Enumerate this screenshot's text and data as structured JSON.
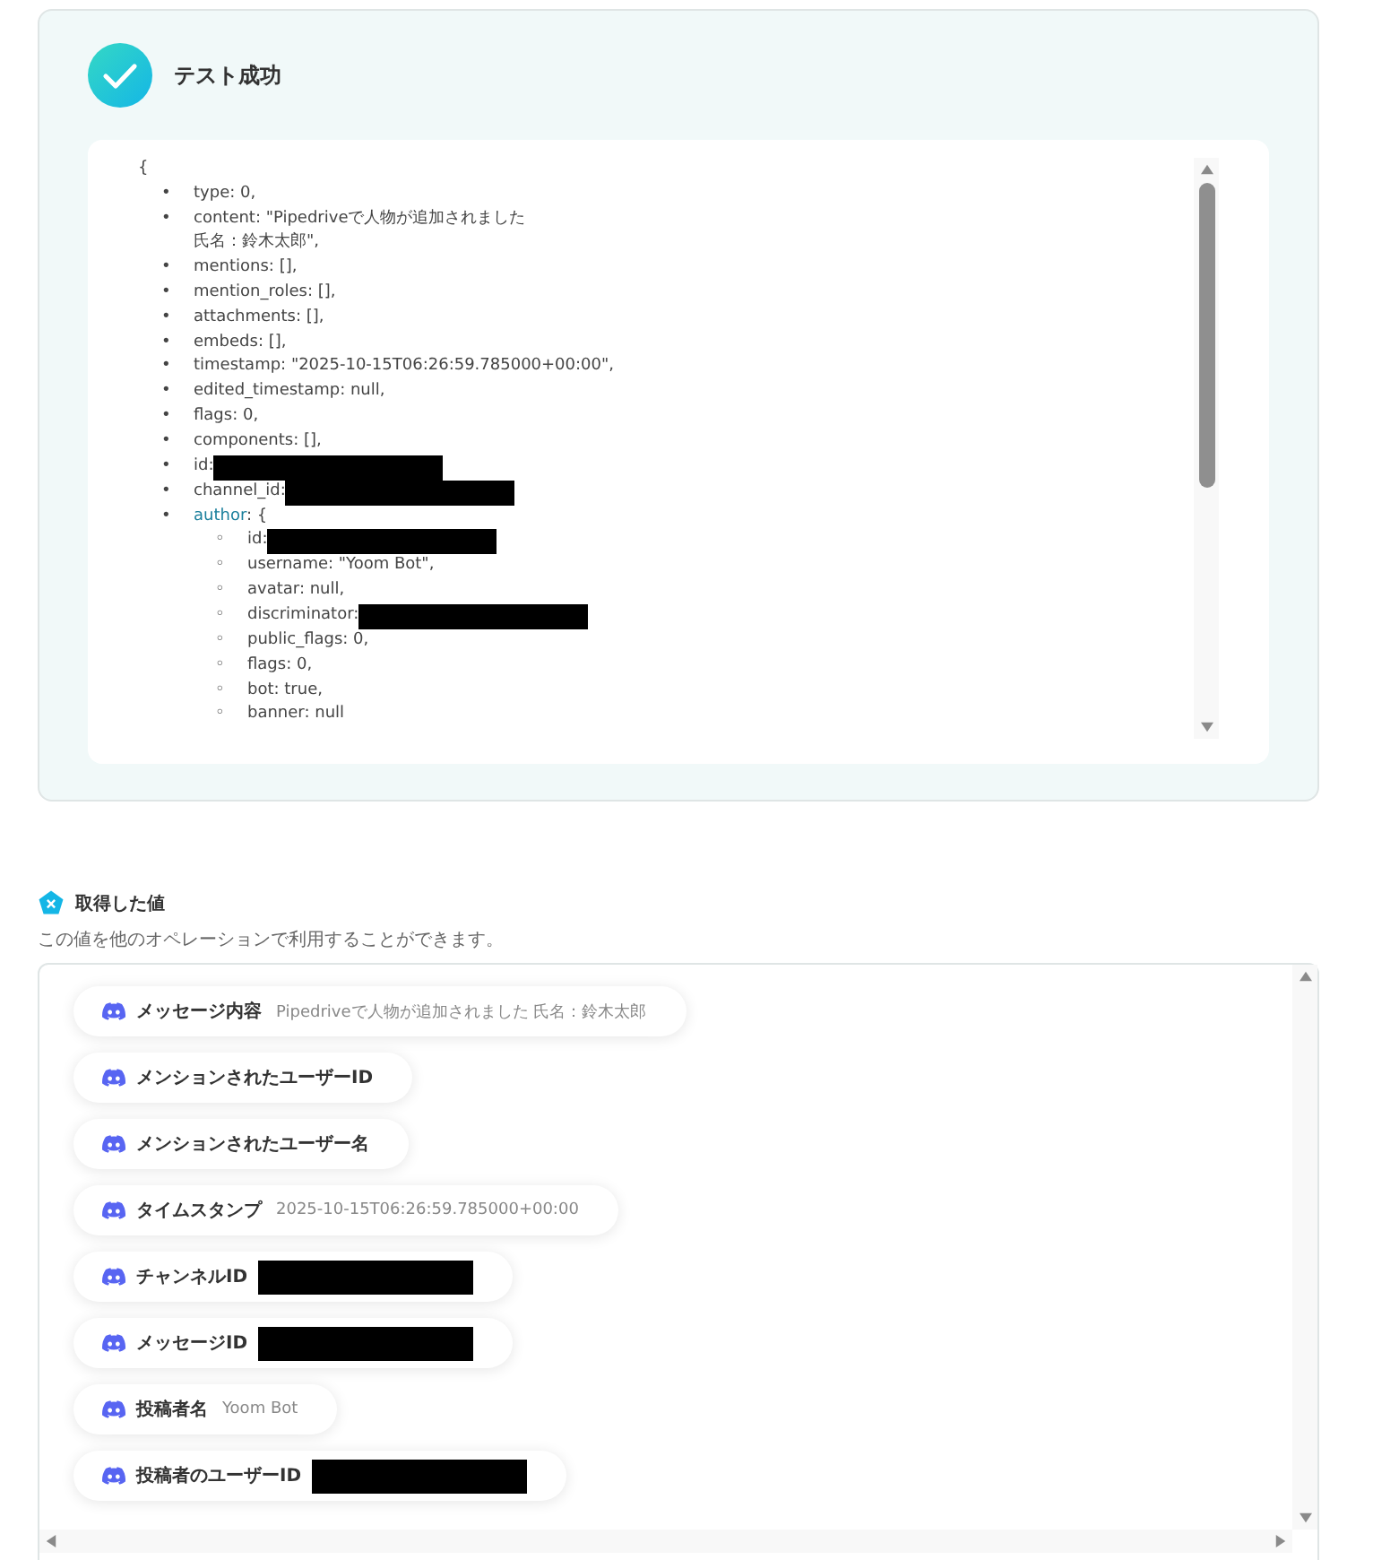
{
  "result": {
    "title": "テスト成功",
    "open_brace": "{",
    "lines": [
      {
        "bullet": "•",
        "text": "type: 0,"
      },
      {
        "bullet": "•",
        "text": "content: \"Pipedriveで人物が追加されました",
        "continuation": "氏名：鈴木太郎\","
      },
      {
        "bullet": "•",
        "text": "mentions: [],"
      },
      {
        "bullet": "•",
        "text": "mention_roles: [],"
      },
      {
        "bullet": "•",
        "text": "attachments: [],"
      },
      {
        "bullet": "•",
        "text": "embeds: [],"
      },
      {
        "bullet": "•",
        "text": "timestamp: \"2025-10-15T06:26:59.785000+00:00\","
      },
      {
        "bullet": "•",
        "text": "edited_timestamp: null,"
      },
      {
        "bullet": "•",
        "text": "flags: 0,"
      },
      {
        "bullet": "•",
        "text": "components: [],"
      },
      {
        "bullet": "•",
        "text": "id:",
        "redacted": true
      },
      {
        "bullet": "•",
        "text": "channel_id:",
        "redacted": true
      },
      {
        "bullet": "•",
        "key": "author",
        "text": ": {",
        "children": [
          {
            "bullet": "◦",
            "text": "id:",
            "redacted": true
          },
          {
            "bullet": "◦",
            "text": "username: \"Yoom Bot\","
          },
          {
            "bullet": "◦",
            "text": "avatar: null,"
          },
          {
            "bullet": "◦",
            "text": "discriminator:",
            "redacted": true
          },
          {
            "bullet": "◦",
            "text": "public_flags: 0,"
          },
          {
            "bullet": "◦",
            "text": "flags: 0,"
          },
          {
            "bullet": "◦",
            "text": "bot: true,"
          },
          {
            "bullet": "◦",
            "text": "banner: null"
          }
        ]
      }
    ]
  },
  "values": {
    "title": "取得した値",
    "description": "この値を他のオペレーションで利用することができます。",
    "chips": [
      {
        "label": "メッセージ内容",
        "value": "Pipedriveで人物が追加されました 氏名：鈴木太郎"
      },
      {
        "label": "メンションされたユーザーID"
      },
      {
        "label": "メンションされたユーザー名"
      },
      {
        "label": "タイムスタンプ",
        "value": "2025-10-15T06:26:59.785000+00:00"
      },
      {
        "label": "チャンネルID",
        "redacted": true
      },
      {
        "label": "メッセージID",
        "redacted": true
      },
      {
        "label": "投稿者名",
        "value": "Yoom Bot"
      },
      {
        "label": "投稿者のユーザーID",
        "redacted": true
      }
    ]
  }
}
